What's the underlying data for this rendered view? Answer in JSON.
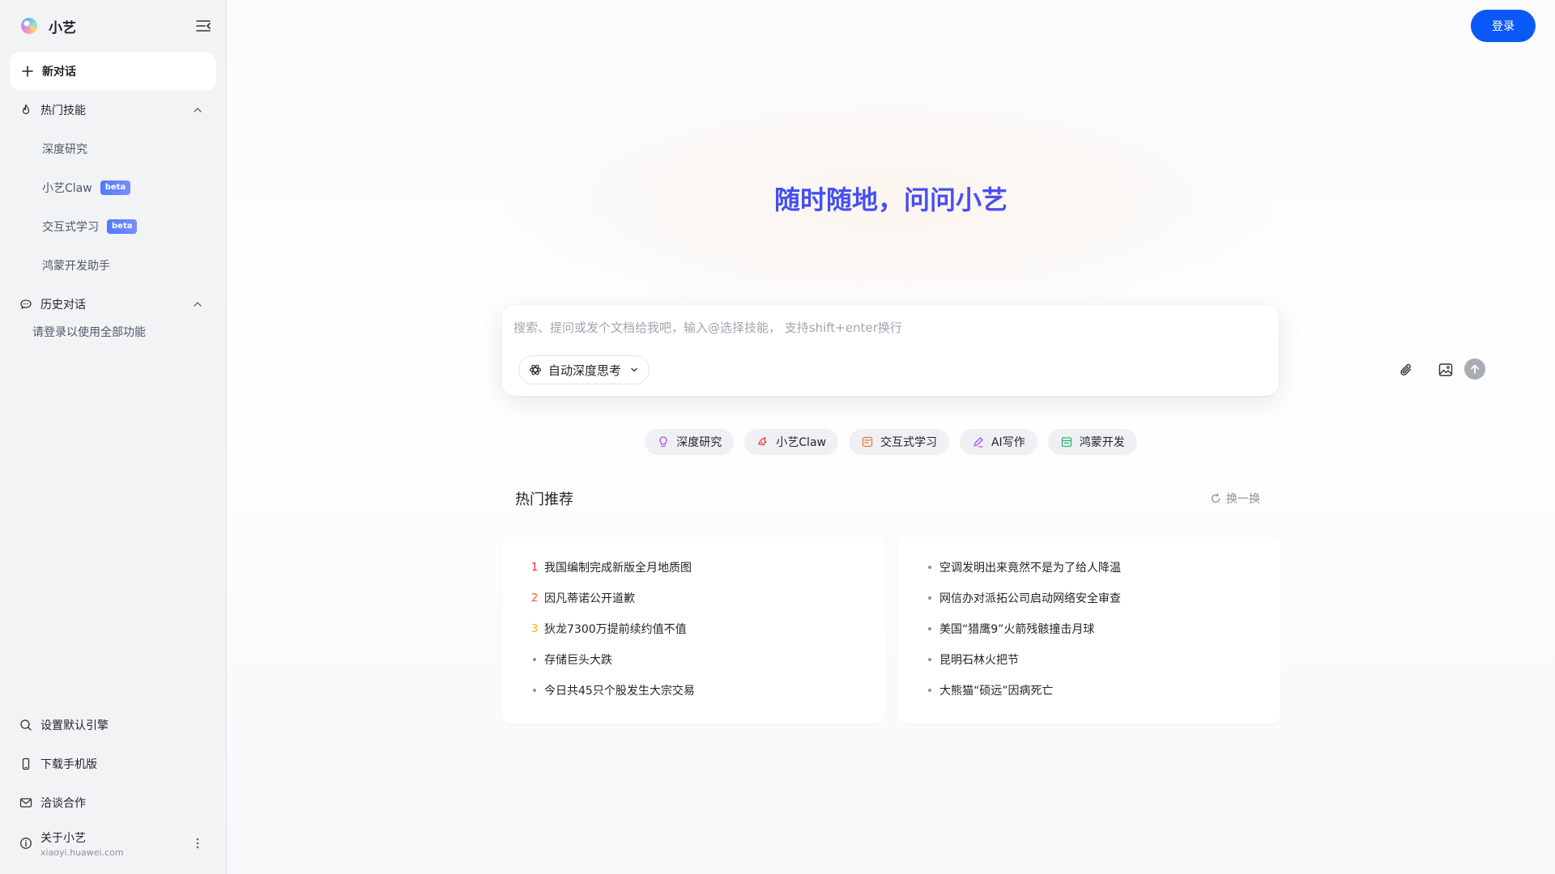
{
  "sidebar": {
    "brand": "小艺",
    "new_chat": "新对话",
    "hot_skills": {
      "label": "热门技能",
      "items": [
        {
          "label": "深度研究",
          "badge": ""
        },
        {
          "label": "小艺Claw",
          "badge": "beta"
        },
        {
          "label": "交互式学习",
          "badge": "beta"
        },
        {
          "label": "鸿蒙开发助手",
          "badge": ""
        }
      ]
    },
    "history": {
      "label": "历史对话",
      "login_hint": "请登录以使用全部功能"
    },
    "bottom": {
      "default_engine": "设置默认引擎",
      "download_mobile": "下载手机版",
      "cooperation": "洽谈合作",
      "about_title": "关于小艺",
      "about_url": "xiaoyi.huawei.com"
    }
  },
  "header": {
    "login": "登录"
  },
  "main": {
    "hero_title": "随时随地，问问小艺",
    "input": {
      "placeholder": "搜索、提问或发个文档给我吧，输入@选择技能， 支持shift+enter换行",
      "value": "",
      "mode": "自动深度思考"
    },
    "chips": [
      {
        "label": "深度研究",
        "icon": "bulb-icon",
        "color": "#b44cf5"
      },
      {
        "label": "小艺Claw",
        "icon": "claw-icon",
        "color": "#ef3b3b"
      },
      {
        "label": "交互式学习",
        "icon": "learning-icon",
        "color": "#f07a2a"
      },
      {
        "label": "AI写作",
        "icon": "pen-icon",
        "color": "#b44cf5"
      },
      {
        "label": "鸿蒙开发",
        "icon": "calendar-code-icon",
        "color": "#2fb36b"
      }
    ],
    "hot": {
      "title": "热门推荐",
      "refresh": "换一换",
      "left": [
        {
          "rank": "1",
          "text": "我国编制完成新版全月地质图"
        },
        {
          "rank": "2",
          "text": "因凡蒂诺公开道歉"
        },
        {
          "rank": "3",
          "text": "狄龙7300万提前续约值不值"
        },
        {
          "rank": "",
          "text": "存储巨头大跌"
        },
        {
          "rank": "",
          "text": "今日共45只个股发生大宗交易"
        }
      ],
      "right": [
        {
          "rank": "",
          "text": "空调发明出来竟然不是为了给人降温"
        },
        {
          "rank": "",
          "text": "网信办对派拓公司启动网络安全审查"
        },
        {
          "rank": "",
          "text": "美国“猎鹰9”火箭残骸撞击月球"
        },
        {
          "rank": "",
          "text": "昆明石林火把节"
        },
        {
          "rank": "",
          "text": "大熊猫“硕远”因病死亡"
        }
      ],
      "rank_colors": {
        "1": "#f5222d",
        "2": "#fa541c",
        "3": "#faad14"
      }
    }
  }
}
